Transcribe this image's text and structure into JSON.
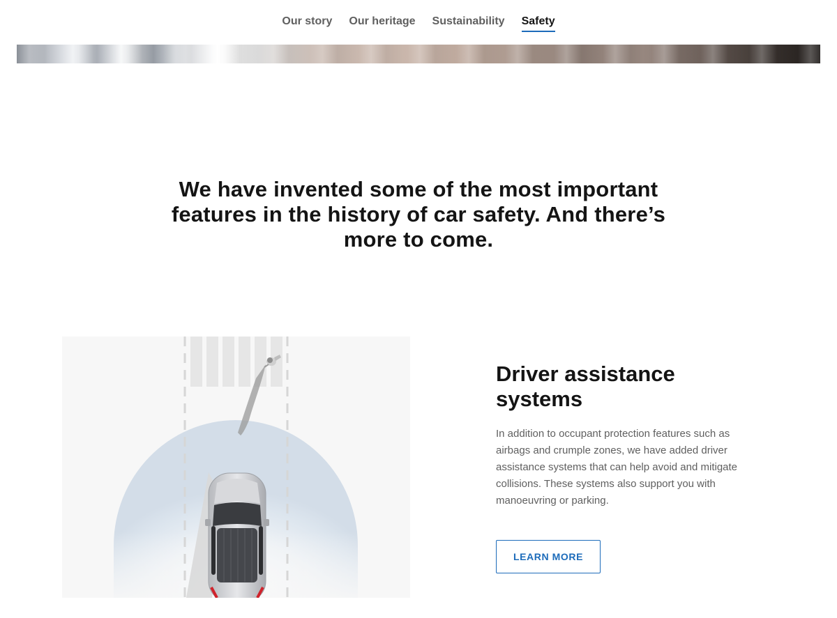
{
  "nav": {
    "items": [
      {
        "label": "Our story",
        "active": false
      },
      {
        "label": "Our heritage",
        "active": false
      },
      {
        "label": "Sustainability",
        "active": false
      },
      {
        "label": "Safety",
        "active": true
      }
    ]
  },
  "headline": "We have invented some of the most important features in the history of car safety. And there’s more to come.",
  "feature": {
    "title": "Driver assistance systems",
    "body": "In addition to occupant protection features such as airbags and crumple zones, we have added driver assistance systems that can help avoid and mitigate collisions. These systems also support you with manoeuvring or parking.",
    "cta": "LEARN MORE"
  },
  "colors": {
    "accent": "#1c6bba",
    "text": "#141414",
    "muted": "#5f5f5f"
  }
}
